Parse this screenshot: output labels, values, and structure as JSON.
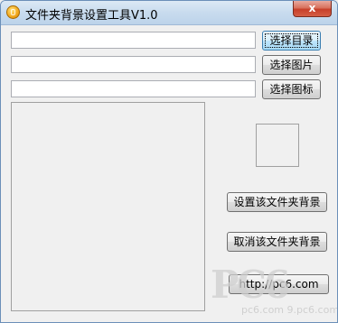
{
  "window": {
    "title": "文件夹背景设置工具V1.0",
    "close_label": "x",
    "app_icon": "app-icon"
  },
  "fields": {
    "directory_value": "",
    "image_value": "",
    "icon_value": ""
  },
  "buttons": {
    "select_directory": "选择目录",
    "select_image": "选择图片",
    "select_icon": "选择图标",
    "set_background": "设置该文件夹背景",
    "cancel_background": "取消该文件夹背景",
    "website": "http://pc6.com"
  },
  "watermark": {
    "brand": "PC6",
    "line": "pc6.com 9.pc6.com"
  },
  "colors": {
    "window_bg": "#f0f0f0",
    "titlebar": "#c8dbee",
    "close_red": "#c7402a",
    "focus_blue": "#3c7fb1"
  }
}
